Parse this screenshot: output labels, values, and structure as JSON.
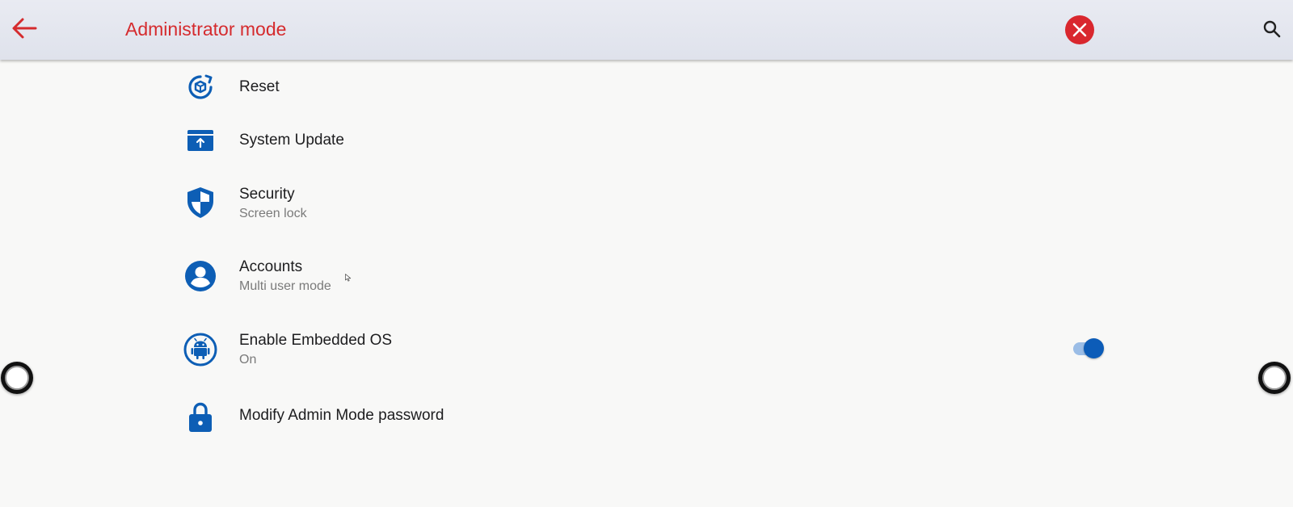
{
  "header": {
    "title": "Administrator mode",
    "back_icon": "arrow-left-icon",
    "close_icon": "close-circle-icon",
    "search_icon": "search-icon",
    "title_color": "#d52b2e"
  },
  "settings": {
    "reset": {
      "label": "Reset",
      "icon": "reset-icon"
    },
    "system_update": {
      "label": "System Update",
      "icon": "system-update-icon"
    },
    "security": {
      "label": "Security",
      "sublabel": "Screen lock",
      "icon": "shield-icon"
    },
    "accounts": {
      "label": "Accounts",
      "sublabel": "Multi user mode",
      "icon": "account-circle-icon"
    },
    "embedded_os": {
      "label": "Enable Embedded OS",
      "sublabel": "On",
      "icon": "android-icon",
      "toggle_on": true
    },
    "admin_password": {
      "label": "Modify Admin Mode password",
      "icon": "lock-icon"
    }
  },
  "colors": {
    "accent": "#0c5cb8",
    "icon_blue": "#0d5eb5",
    "close_red": "#d9272e"
  }
}
